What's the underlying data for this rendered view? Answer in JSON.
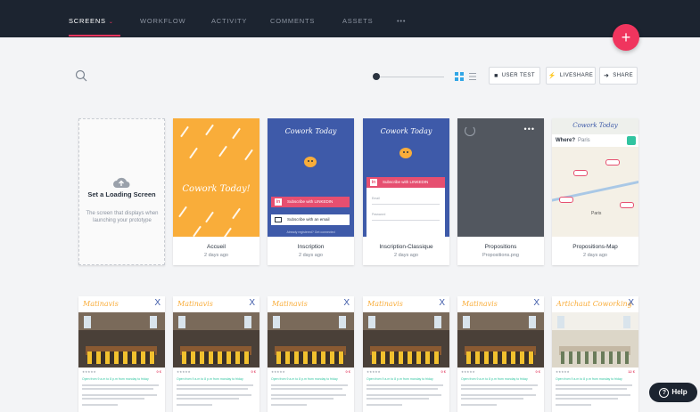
{
  "nav": {
    "tabs": [
      {
        "label": "SCREENS"
      },
      {
        "label": "WORKFLOW"
      },
      {
        "label": "ACTIVITY"
      },
      {
        "label": "COMMENTS"
      },
      {
        "label": "ASSETS"
      },
      {
        "label": "•••"
      }
    ],
    "active_tab": "SCREENS",
    "caret": "⌄",
    "add_button": "+"
  },
  "toolbar": {
    "search_icon": "search-icon",
    "zoom_level": 0.05,
    "buttons": [
      {
        "label": "USER TEST",
        "icon": "camera-icon"
      },
      {
        "label": "LIVESHARE",
        "icon": "bolt-icon"
      },
      {
        "label": "SHARE",
        "icon": "arrow-icon"
      }
    ]
  },
  "loading_card": {
    "title": "Set a Loading Screen",
    "text": "The screen that displays when launching your prototype"
  },
  "screens": [
    {
      "name": "Accueil",
      "date": "2 days ago",
      "logo": "Cowork Today!"
    },
    {
      "name": "Inscription",
      "date": "2 days ago",
      "logo": "Cowork Today",
      "linkedin": "Subscribe with LINKEDIN",
      "email": "Subscribe with an email",
      "footer": "Already registered? Get connected"
    },
    {
      "name": "Inscription-Classique",
      "date": "2 days ago",
      "logo": "Cowork Today",
      "linkedin": "Subscribe with LINKEDIN",
      "field1": "Email",
      "field2": "Password"
    },
    {
      "name": "Propositions",
      "date": "Propositions.png",
      "menu": "•••"
    },
    {
      "name": "Propositions-Map",
      "date": "2 days ago",
      "logo": "Cowork Today",
      "where": "Where?",
      "city": "Paris",
      "map_label": "Paris"
    }
  ],
  "row2": [
    {
      "brand": "Matinavis",
      "close": "X",
      "price": "0 €",
      "hours": "Open from 9 a.m to 8 p.m from monday to friday"
    },
    {
      "brand": "Matinavis",
      "close": "X",
      "price": "0 €",
      "hours": "Open from 9 a.m to 8 p.m from monday to friday"
    },
    {
      "brand": "Matinavis",
      "close": "X",
      "price": "0 €",
      "hours": "Open from 9 a.m to 8 p.m from monday to friday"
    },
    {
      "brand": "Matinavis",
      "close": "X",
      "price": "0 €",
      "hours": "Open from 9 a.m to 8 p.m from monday to friday"
    },
    {
      "brand": "Matinavis",
      "close": "X",
      "price": "0 €",
      "hours": "Open from 9 a.m to 8 p.m from monday to friday"
    },
    {
      "brand": "Artichaut Coworking",
      "close": "X",
      "price": "12 €",
      "hours": "Open from 9 a.m to 8 p.m from monday to friday"
    }
  ],
  "help": {
    "label": "Help",
    "icon": "?"
  },
  "colors": {
    "nav_bg": "#1c2430",
    "accent": "#f0355e",
    "brand_blue": "#3e5aa9",
    "brand_yellow": "#f9ad3a"
  }
}
